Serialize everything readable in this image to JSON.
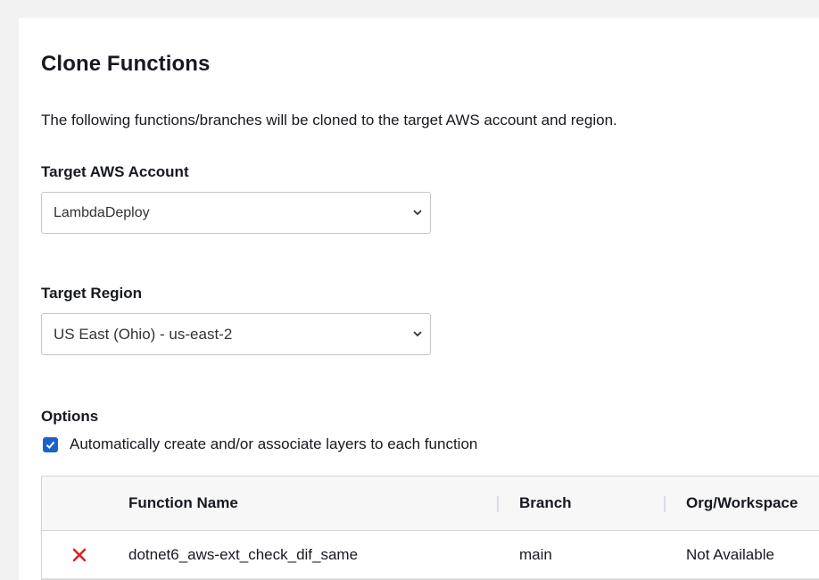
{
  "page": {
    "title": "Clone Functions",
    "description": "The following functions/branches will be cloned to the target AWS account and region."
  },
  "account": {
    "label": "Target AWS Account",
    "value": "LambdaDeploy"
  },
  "region": {
    "label": "Target Region",
    "value": "US East (Ohio) - us-east-2"
  },
  "options": {
    "label": "Options",
    "auto_layers_label": "Automatically create and/or associate layers to each function",
    "auto_layers_checked": true
  },
  "table": {
    "columns": [
      "Function Name",
      "Branch",
      "Org/Workspace"
    ],
    "rows": [
      {
        "function_name": "dotnet6_aws-ext_check_dif_same",
        "branch": "main",
        "org_workspace": "Not Available",
        "remove_icon": "x-icon"
      }
    ]
  },
  "colors": {
    "accent": "#1a62c8",
    "remove": "#e02020"
  }
}
